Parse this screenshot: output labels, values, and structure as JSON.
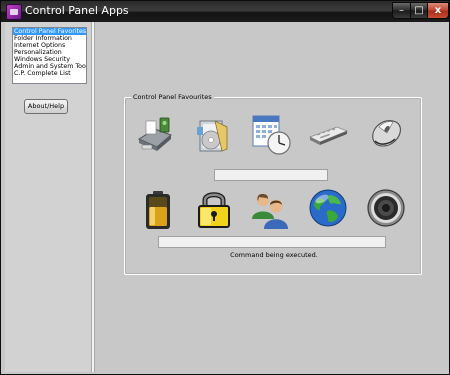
{
  "window": {
    "title": "Control Panel Apps",
    "caption_buttons": {
      "minimize": "–",
      "maximize": "□",
      "close": "x"
    }
  },
  "sidebar": {
    "items": [
      {
        "label": "Control Panel Favorites",
        "selected": true
      },
      {
        "label": "Folder Information",
        "selected": false
      },
      {
        "label": "Internet Options",
        "selected": false
      },
      {
        "label": "Personalization",
        "selected": false
      },
      {
        "label": "Windows Security",
        "selected": false
      },
      {
        "label": "Admin and System Tools",
        "selected": false
      },
      {
        "label": "C.P. Complete List",
        "selected": false
      }
    ],
    "about_button": "About/Help"
  },
  "main": {
    "group_title": "Control Panel Favourites",
    "icons_row1": [
      "devices-printers-icon",
      "programs-features-icon",
      "date-time-icon",
      "keyboard-icon",
      "mouse-icon"
    ],
    "icons_row2": [
      "power-battery-icon",
      "lock-icon",
      "user-accounts-icon",
      "globe-icon",
      "speaker-icon"
    ],
    "textbox1_value": "",
    "textbox2_value": "",
    "status_text": "Command being executed."
  },
  "colors": {
    "selection": "#3399ff",
    "titlebar": "#1b1b1b",
    "client_bg": "#c8c8c8"
  }
}
